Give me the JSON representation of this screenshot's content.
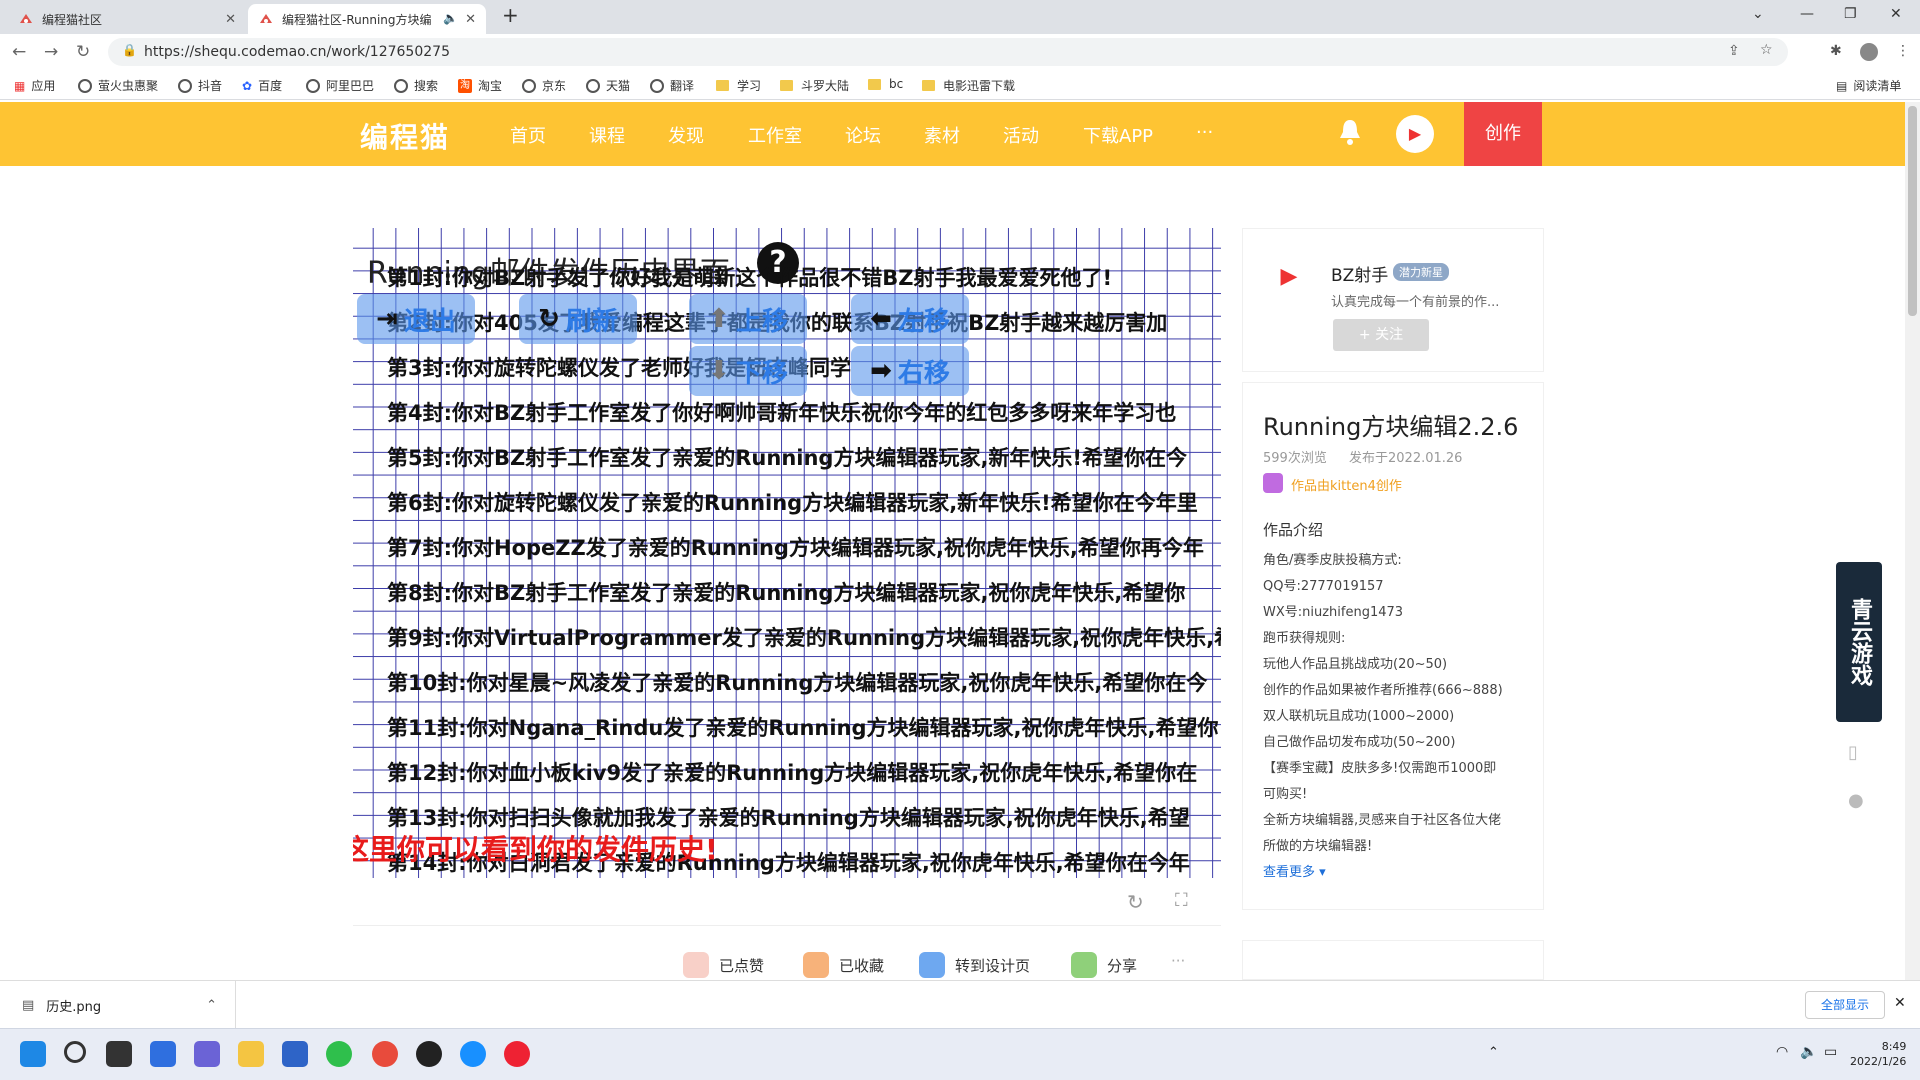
{
  "browser": {
    "tabs": [
      {
        "title": "编程猫社区"
      },
      {
        "title": "编程猫社区-Running方块编"
      }
    ],
    "url": "https://shequ.codemao.cn/work/127650275",
    "bookmarks": [
      "应用",
      "萤火虫惠聚",
      "抖音",
      "百度",
      "阿里巴巴",
      "搜索",
      "淘宝",
      "京东",
      "天猫",
      "翻译",
      "学习",
      "斗罗大陆",
      "bc",
      "电影迅雷下载"
    ],
    "reading_list": "阅读清单"
  },
  "site": {
    "logo": "编程猫",
    "nav": [
      "首页",
      "课程",
      "发现",
      "工作室",
      "论坛",
      "素材",
      "活动",
      "下载APP",
      "···"
    ],
    "create": "创作"
  },
  "stage": {
    "title": "Running邮件发件历史界面",
    "help": "?",
    "buttons": {
      "exit": "退出",
      "refresh": "刷新",
      "up": "上移",
      "left": "左移",
      "down": "下移",
      "right": "右移"
    },
    "rows": [
      "第1封:你对BZ射手发了你好我是萌新这个作品很不错BZ射手我最爱爱死他了!",
      "第2封:你对405发了我爱编程这辈子都是我你的联系BZ射手祝BZ射手越来越厉害加",
      "第3封:你对旋转陀螺仪发了老师好我是钮志峰同学",
      "第4封:你对BZ射手工作室发了你好啊帅哥新年快乐祝你今年的红包多多呀来年学习也",
      "第5封:你对BZ射手工作室发了亲爱的Running方块编辑器玩家,新年快乐!希望你在今",
      "第6封:你对旋转陀螺仪发了亲爱的Running方块编辑器玩家,新年快乐!希望你在今年里",
      "第7封:你对HopeZZ发了亲爱的Running方块编辑器玩家,祝你虎年快乐,希望你再今年",
      "第8封:你对BZ射手工作室发了亲爱的Running方块编辑器玩家,祝你虎年快乐,希望你",
      "第9封:你对VirtualProgrammer发了亲爱的Running方块编辑器玩家,祝你虎年快乐,希",
      "第10封:你对星晨~风凌发了亲爱的Running方块编辑器玩家,祝你虎年快乐,希望你在今",
      "第11封:你对Ngana_Rindu发了亲爱的Running方块编辑器玩家,祝你虎年快乐,希望你",
      "第12封:你对血小板kiv9发了亲爱的Running方块编辑器玩家,祝你虎年快乐,希望你在",
      "第13封:你对扫扫头像就加我发了亲爱的Running方块编辑器玩家,祝你虎年快乐,希望",
      "第14封:你对白洞君发了亲爱的Running方块编辑器玩家,祝你虎年快乐,希望你在今年"
    ],
    "tip": "这里你可以看到你的发件历史!"
  },
  "actions": [
    "已点赞",
    "已收藏",
    "转到设计页",
    "分享",
    "···"
  ],
  "author": {
    "name": "BZ射手",
    "badge": "潜力新星",
    "bio": "认真完成每一个有前景的作...",
    "follow": "+ 关注"
  },
  "work": {
    "title": "Running方块编辑2.2.6",
    "views": "599次浏览",
    "published": "发布于2022.01.26",
    "made_with": "作品由kitten4创作",
    "intro_label": "作品介绍",
    "intro_lines": [
      "角色/赛季皮肤投稿方式:",
      "QQ号:2777019157",
      "WX号:niuzhifeng1473",
      "跑币获得规则:",
      "玩他人作品且挑战成功(20~50)",
      "创作的作品如果被作者所推荐(666~888)",
      "双人联机玩且成功(1000~2000)",
      "自己做作品切发布成功(50~200)",
      "【赛季宝藏】皮肤多多!仅需跑币1000即",
      "可购买!",
      "全新方块编辑器,灵感来自于社区各位大佬",
      "所做的方块编辑器!"
    ],
    "more": "查看更多"
  },
  "ad": {
    "text": "青云游戏"
  },
  "download": {
    "file": "历史.png",
    "show_all": "全部显示"
  },
  "taskbar": {
    "time": "8:49",
    "date": "2022/1/26"
  }
}
